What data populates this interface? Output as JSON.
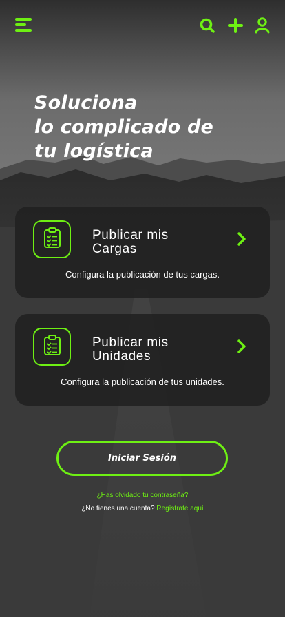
{
  "header": {
    "icons": [
      "menu-icon",
      "search-icon",
      "plus-icon",
      "user-icon"
    ]
  },
  "hero": {
    "lines": [
      "Soluciona",
      "lo complicado de",
      "tu logística"
    ]
  },
  "cards": [
    {
      "icon": "clipboard-checklist-icon",
      "title_line1": "Publicar mis",
      "title_line2": "Cargas",
      "description": "Configura la publicación de tus cargas."
    },
    {
      "icon": "clipboard-checklist-icon",
      "title_line1": "Publicar mis",
      "title_line2": "Unidades",
      "description": "Configura la publicación de tus unidades."
    }
  ],
  "auth": {
    "login_label": "Iniciar Sesión",
    "forgot_password": "¿Has olvidado tu contraseña?",
    "no_account": "¿No tienes una cuenta?",
    "register_link": "Regístrate aquí"
  },
  "colors": {
    "accent": "#6ef013",
    "card_bg": "#222222",
    "text": "#ffffff"
  }
}
